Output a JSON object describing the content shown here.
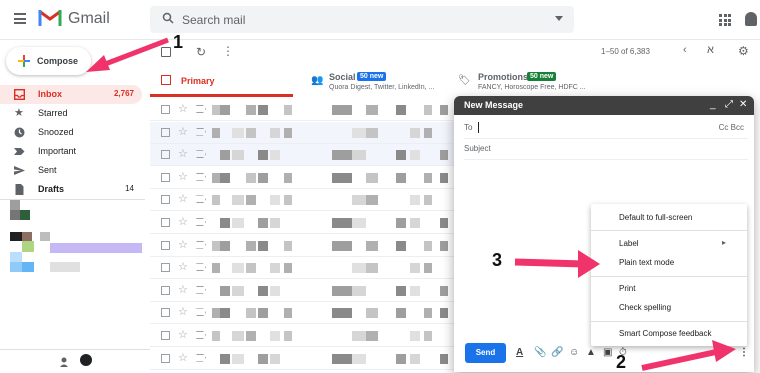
{
  "header": {
    "app_name": "Gmail",
    "search_placeholder": "Search mail",
    "pager": "1–50 of 6,383"
  },
  "compose": {
    "label": "Compose"
  },
  "sidebar": {
    "items": [
      {
        "label": "Inbox",
        "count": "2,767",
        "icon": "inbox-icon"
      },
      {
        "label": "Starred",
        "count": "",
        "icon": "star-icon"
      },
      {
        "label": "Snoozed",
        "count": "",
        "icon": "clock-icon"
      },
      {
        "label": "Important",
        "count": "",
        "icon": "important-icon"
      },
      {
        "label": "Sent",
        "count": "",
        "icon": "send-icon"
      },
      {
        "label": "Drafts",
        "count": "14",
        "icon": "file-icon"
      }
    ]
  },
  "tabs": [
    {
      "label": "Primary",
      "badge": "",
      "sub": ""
    },
    {
      "label": "Social",
      "badge": "50 new",
      "sub": "Quora Digest, Twitter, LinkedIn, ..."
    },
    {
      "label": "Promotions",
      "badge": "50 new",
      "sub": "FANCY, Horoscope Free, HDFC ..."
    }
  ],
  "compose_window": {
    "title": "New Message",
    "to_label": "To",
    "cc_bcc": "Cc Bcc",
    "subject_placeholder": "Subject",
    "send_label": "Send"
  },
  "more_menu": {
    "items": [
      "Default to full-screen",
      "Label",
      "Plain text mode",
      "Print",
      "Check spelling",
      "Smart Compose feedback"
    ]
  },
  "annotations": [
    "1",
    "2",
    "3"
  ],
  "colors": {
    "accent_red": "#d93025",
    "send_blue": "#1a73e8",
    "arrow_pink": "#f0336a",
    "badge_social": "#1a73e8",
    "badge_promo": "#188038"
  }
}
